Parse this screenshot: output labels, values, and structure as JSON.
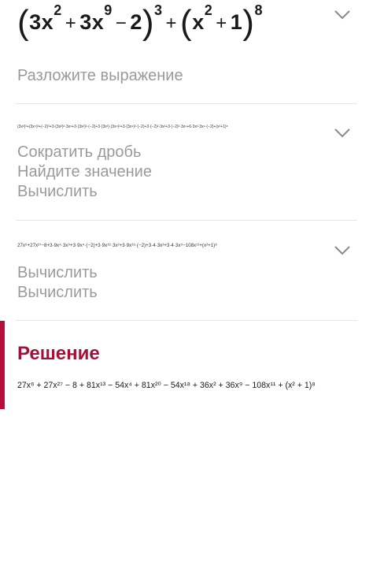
{
  "problem": {
    "expression_parts": [
      "(",
      "3x",
      "2",
      "+",
      "3x",
      "9",
      "−",
      "2",
      ")",
      "3",
      "+",
      "(",
      "x",
      "2",
      "+",
      "1",
      ")",
      "8"
    ],
    "hint": "Разложите выражение"
  },
  "result1": {
    "expression": "(3x²)³+(3x⁹)³+(−2)³+3·(3x²)²·3x⁹+3·(3x²)²·(−2)+3·(3x²)·(3x⁹)²+3·(3x⁹)²·(−2)+3·(−2)²·3x²+3·(−2)²·3x⁹+6·3x²·3x⁹·(−2)+(x²+1)⁸",
    "steps": [
      "Сократить дробь",
      "Найдите значение",
      "Вычислить"
    ]
  },
  "result2": {
    "expression": "27x⁶+27x²⁷−8+3·9x⁴·3x⁹+3·9x⁴·(−2)+3·9x¹⁸·3x²+3·9x¹⁸·(−2)+3·4·3x²+3·4·3x⁹−108x¹¹+(x²+1)⁸",
    "steps": [
      "Вычислить",
      "Вычислить"
    ]
  },
  "solution": {
    "title": "Решение",
    "expression": "27x⁶ + 27x²⁷ − 8 + 81x¹³ − 54x⁴ + 81x²⁰ − 54x¹⁸ + 36x² + 36x⁹ − 108x¹¹ + (x² + 1)⁸"
  },
  "colors": {
    "accent": "#b5103c",
    "muted_text": "#9a9a9a",
    "divider": "#e6e6e6"
  },
  "icons": [
    "chevron-down-icon"
  ]
}
